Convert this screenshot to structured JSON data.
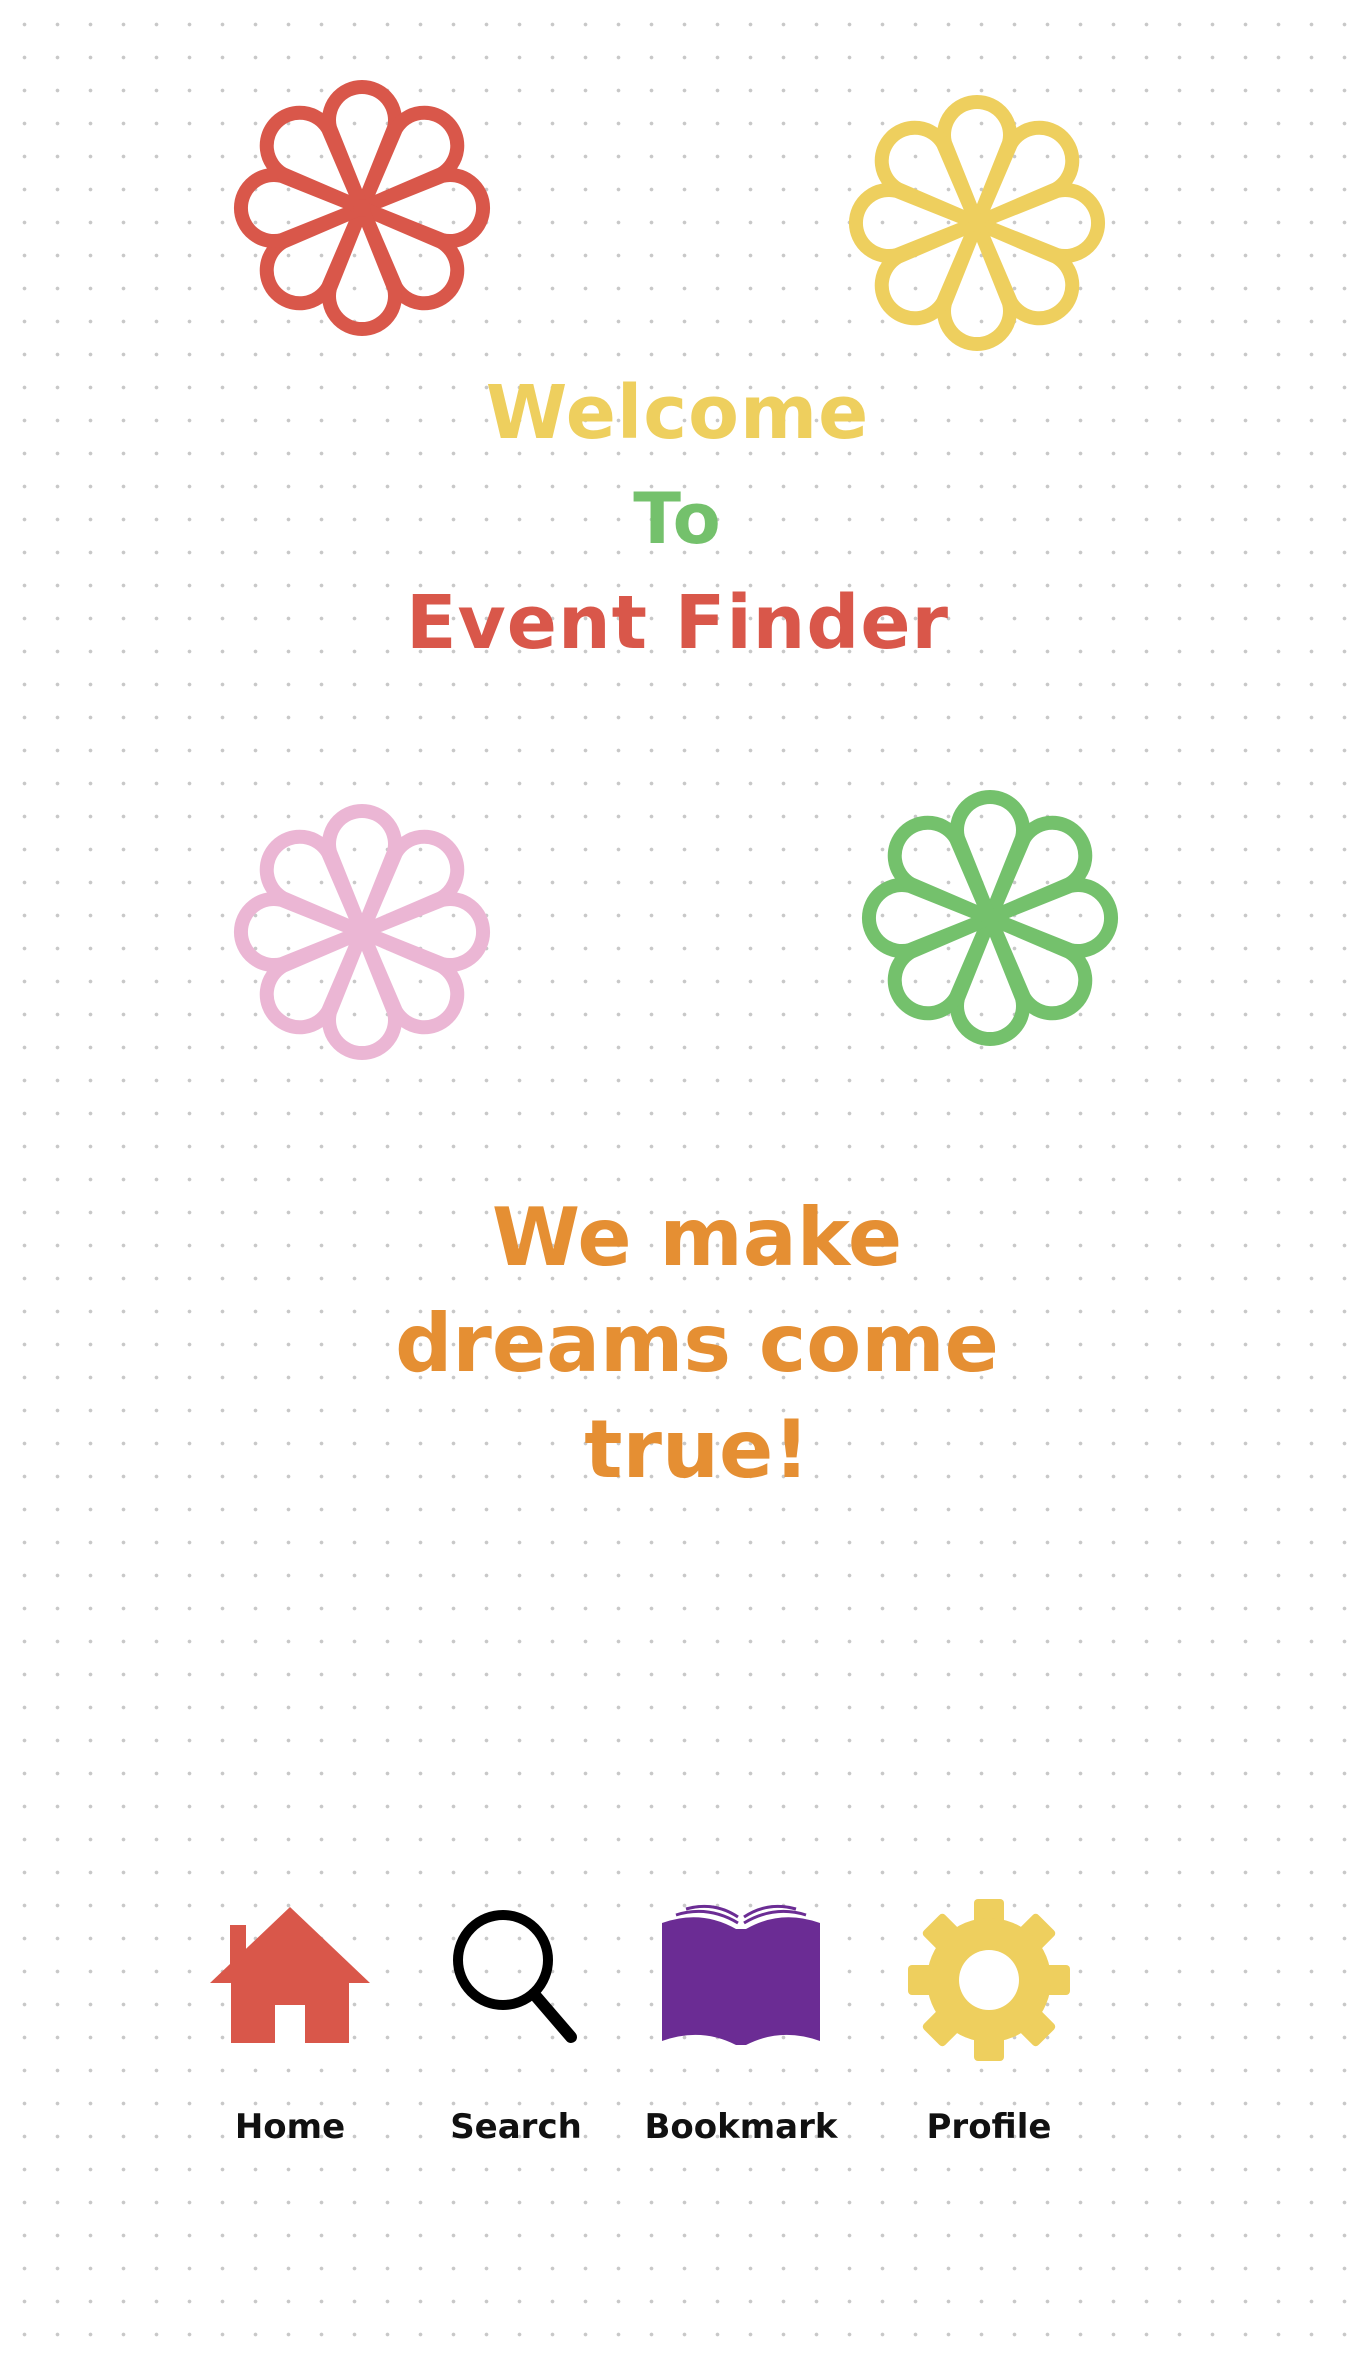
{
  "colors": {
    "red": "#D9574A",
    "yellow": "#EECF5E",
    "green": "#74C16C",
    "pink": "#EBB6D4",
    "orange": "#E58F33",
    "purple": "#6B2C94",
    "black": "#000000"
  },
  "header": {
    "welcome": "Welcome",
    "to": "To",
    "app_name": "Event Finder"
  },
  "tagline": "We make dreams come true!",
  "decorations": [
    {
      "icon": "flower-icon",
      "color": "red"
    },
    {
      "icon": "flower-icon",
      "color": "yellow"
    },
    {
      "icon": "flower-icon",
      "color": "pink"
    },
    {
      "icon": "flower-icon",
      "color": "green"
    }
  ],
  "nav": {
    "items": [
      {
        "label": "Home",
        "icon": "home-icon",
        "color": "red"
      },
      {
        "label": "Search",
        "icon": "search-icon",
        "color": "black"
      },
      {
        "label": "Bookmark",
        "icon": "book-icon",
        "color": "purple"
      },
      {
        "label": "Profile",
        "icon": "gear-icon",
        "color": "yellow"
      }
    ]
  }
}
